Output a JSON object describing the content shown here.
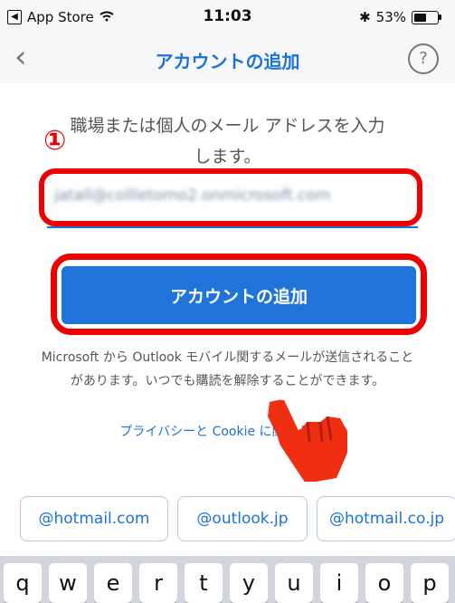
{
  "status_bar": {
    "app": "App Store",
    "time": "11:03",
    "battery": "53%",
    "battery_level": 0.53
  },
  "nav": {
    "title": "アカウントの追加",
    "help": "?"
  },
  "form": {
    "step_number": "①",
    "instruction_line1": "職場または個人のメール アドレスを入力",
    "instruction_line2": "します。",
    "email_value": "jatall@collletomo2.onmicrosoft.com",
    "add_button": "アカウントの追加"
  },
  "notice": {
    "text": "Microsoft から Outlook モバイル関するメールが送信されることがあります。いつでも購読を解除することができます。",
    "privacy_link": "プライバシーと Cookie に関する声明"
  },
  "suggestions": [
    "@hotmail.com",
    "@outlook.jp",
    "@hotmail.co.jp"
  ],
  "keyboard": {
    "row1": [
      "q",
      "w",
      "e",
      "r",
      "t",
      "y",
      "u",
      "i",
      "o",
      "p"
    ]
  },
  "colors": {
    "accent": "#1f73d9",
    "highlight": "#e00000"
  }
}
